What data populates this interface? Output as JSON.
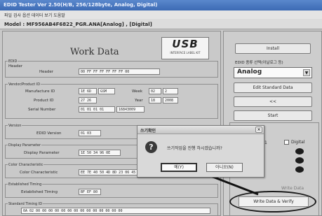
{
  "window": {
    "title": "EDID Tester Ver 2.50(H/B, 256/128byte, Analog, Digital)",
    "menu": "파일 검사 옵션 데이터 보기 도움말",
    "model": "Model : MF956AB4F6822_PGR.ANA[Analog] , [Digital]"
  },
  "work": {
    "title": "Work Data",
    "logo_text": "USB",
    "logo_sub": "INTERFACE LABEL KIT",
    "groups": {
      "edid_label": "EDID",
      "header_group": "Header",
      "header_label": "Header",
      "header_value": "00 FF FF FF FF FF FF 00",
      "vendor_group": "Vendor/Product ID",
      "manufacture_label": "Manufacture ID",
      "manufacture_value": "1E 6D",
      "manufacture_code": "GSM",
      "week_label": "Week",
      "week_value": "02",
      "week_num": "2",
      "product_label": "Product ID",
      "product_value": "27 26",
      "year_label": "Year",
      "year_value": "18",
      "year_full": "2008",
      "serial_label": "Serial Number",
      "serial_value": "01 01 01 01",
      "serial_decimal": "16843009",
      "version_group": "Version",
      "version_label": "EDID Version",
      "version_value": "01 03",
      "display_group": "Display Parameter",
      "display_label": "Display Parameter",
      "display_value": "1E 50 34 96 0E",
      "color_group": "Color Characteristic",
      "color_label": "Color Characteristic",
      "color_value": "EE 7E 40 50 4D 8D 23 06 45 50",
      "timing_group": "Established Timing",
      "timing_label": "Established Timing",
      "timing_value": "BF EF 80",
      "standard_group": "Standard Timing ID",
      "standard_value": "0A 02 00 00 00 00 00 00 00 00 00 00 00 00 00 00"
    }
  },
  "right": {
    "install_button": "Install",
    "select_label": "EDID 종류 선택(아날로그 등)",
    "mode_value": "Analog",
    "edit_button": "Edit Standard Data",
    "arrow_button": "<<",
    "start_button": "Start",
    "digital_label": "Digital",
    "digital_left": "1",
    "faded_button": "Write Data",
    "verify_button": "Write Data & Verify"
  },
  "dialog": {
    "title": "쓰기확인",
    "icon": "?",
    "message": "쓰기작업을 진행 하시겠습니까?",
    "yes_button": "예(Y)",
    "no_button": "아니오(N)"
  },
  "colors": {
    "titlebar": "#4a78c0",
    "panel": "#c9c9c9",
    "led": "#1c1c1c"
  }
}
